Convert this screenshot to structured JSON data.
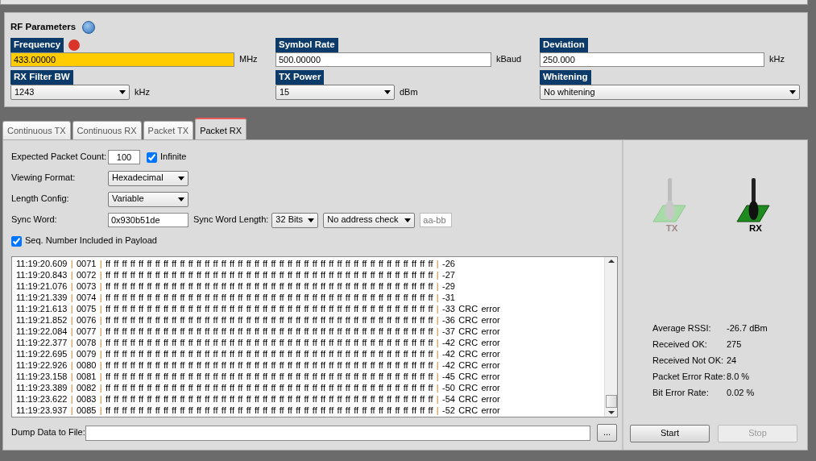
{
  "rf_parameters": {
    "title": "RF Parameters",
    "fields": [
      {
        "label": "Frequency",
        "kind": "input",
        "value": "433.00000",
        "unit": "MHz",
        "warning": true
      },
      {
        "label": "Symbol Rate",
        "kind": "input",
        "value": "500.00000",
        "unit": "kBaud",
        "warning": false
      },
      {
        "label": "Deviation",
        "kind": "input",
        "value": "250.000",
        "unit": "kHz",
        "warning": false
      },
      {
        "label": "RX Filter BW",
        "kind": "select",
        "value": "1243",
        "unit": "kHz",
        "warning": false
      },
      {
        "label": "TX Power",
        "kind": "select",
        "value": "15",
        "unit": "dBm",
        "warning": false
      },
      {
        "label": "Whitening",
        "kind": "select",
        "value": "No whitening",
        "warning": false
      }
    ]
  },
  "tabs": [
    {
      "label": "Continuous TX",
      "selected": false
    },
    {
      "label": "Continuous RX",
      "selected": false
    },
    {
      "label": "Packet TX",
      "selected": false
    },
    {
      "label": "Packet RX",
      "selected": true
    }
  ],
  "packet_rx": {
    "expected_packet_count": {
      "label": "Expected Packet Count:",
      "value": "100"
    },
    "infinite": {
      "label": "Infinite",
      "checked": true
    },
    "viewing_format": {
      "label": "Viewing Format:",
      "value": "Hexadecimal"
    },
    "length_config": {
      "label": "Length Config:",
      "value": "Variable"
    },
    "sync_word": {
      "label": "Sync Word:",
      "value": "0x930b51de"
    },
    "sync_word_length": {
      "label": "Sync Word Length:",
      "value": "32 Bits"
    },
    "address_check": {
      "value": "No address check"
    },
    "address": {
      "value": "aa-bb",
      "disabled": true
    },
    "seq_number": {
      "label": "Seq. Number Included in Payload",
      "checked": true
    },
    "log": [
      {
        "line": "11:19:20.609 | 0071 | ff ff ff ff ff ff ff ff ff ff ff ff ff ff ff ff ff ff ff ff ff ff ff ff ff ff ff ff ff ff ff ff ff ff ff ff ff ff ff ff  |  -26"
      },
      {
        "line": "11:19:20.843 | 0072 | ff ff ff ff ff ff ff ff ff ff ff ff ff ff ff ff ff ff ff ff ff ff ff ff ff ff ff ff ff ff ff ff ff ff ff ff ff ff ff ff  |  -27"
      },
      {
        "line": "11:19:21.076 | 0073 | ff ff ff ff ff ff ff ff ff ff ff ff ff ff ff ff ff ff ff ff ff ff ff ff ff ff ff ff ff ff ff ff ff ff ff ff ff ff ff ff  |  -29"
      },
      {
        "line": "11:19:21.339 | 0074 | ff ff ff ff ff ff ff ff ff ff ff ff ff ff ff ff ff ff ff ff ff ff ff ff ff ff ff ff ff ff ff ff ff ff ff ff ff ff ff ff  |  -31"
      },
      {
        "line": "11:19:21.613 | 0075 | ff ff ff ff ff ff ff ff ff ff ff ff ff ff ff ff ff ff ff ff ff ff ff ff ff ff ff ff ff ff ff ff ff ff ff ff ff ff ff ff  |  -33 CRC error"
      },
      {
        "line": "11:19:21.852 | 0076 | ff ff ff ff ff ff ff ff ff ff ff ff ff ff ff ff ff ff ff ff ff ff ff ff ff ff ff ff ff ff ff ff ff ff ff ff ff ff ff ff  |  -36 CRC error"
      },
      {
        "line": "11:19:22.084 | 0077 | ff ff ff ff ff ff ff ff ff ff ff ff ff ff ff ff ff ff ff ff ff ff ff ff ff ff ff ff ff ff ff ff ff ff ff ff ff ff ff ff  |  -37 CRC error"
      },
      {
        "line": "11:19:22.377 | 0078 | ff ff ff ff ff ff ff ff ff ff ff ff ff ff ff ff ff ff ff ff ff ff ff ff ff ff ff ff ff ff ff ff ff ff ff ff ff ff ff ff  |  -42 CRC error"
      },
      {
        "line": "11:19:22.695 | 0079 | ff ff ff ff ff ff ff ff ff ff ff ff ff ff ff ff ff ff ff ff ff ff ff ff ff ff ff ff ff ff ff ff ff ff ff ff ff ff ff ff  |  -42 CRC error"
      },
      {
        "line": "11:19:22.926 | 0080 | ff ff ff ff ff ff ff ff ff ff ff ff ff ff ff ff ff ff ff ff ff ff ff ff ff ff ff ff ff ff ff ff ff ff ff ff ff ff ff ff  |  -42 CRC error"
      },
      {
        "line": "11:19:23.158 | 0081 | ff ff ff ff ff ff ff ff ff ff ff ff ff ff ff ff ff ff ff ff ff ff ff ff ff ff ff ff ff ff ff ff ff ff ff ff ff ff ff ff  |  -45 CRC error"
      },
      {
        "line": "11:19:23.389 | 0082 | ff ff ff ff ff ff ff ff ff ff ff ff ff ff ff ff ff ff ff ff ff ff ff ff ff ff ff ff ff ff ff ff ff ff ff ff ff ff ff ff  |  -50 CRC error"
      },
      {
        "line": "11:19:23.622 | 0083 | ff ff ff ff ff ff ff ff ff ff ff ff ff ff ff ff ff ff ff ff ff ff ff ff ff ff ff ff ff ff ff ff ff ff ff ff ff ff ff ff  |  -54 CRC error"
      },
      {
        "line": "11:19:23.937 | 0085 | ff ff ff ff ff ff ff ff ff ff ff ff ff ff ff ff ff ff ff ff ff ff ff ff ff ff ff ff ff ff ff ff ff ff ff ff ff ff ff ff  |  -52 CRC error"
      }
    ],
    "dump": {
      "label": "Dump Data to File:",
      "browse": "..."
    },
    "indicators": [
      {
        "label": "TX",
        "active": false
      },
      {
        "label": "RX",
        "active": true
      }
    ],
    "stats": [
      {
        "label": "Average RSSI:",
        "value": "-26.7 dBm"
      },
      {
        "label": "Received OK:",
        "value": "275"
      },
      {
        "label": "Received Not OK:",
        "value": "24"
      },
      {
        "label": "Packet Error Rate:",
        "value": "8.0 %"
      },
      {
        "label": "Bit Error Rate:",
        "value": "0.02 %"
      }
    ],
    "buttons": [
      {
        "label": "Start",
        "disabled": false
      },
      {
        "label": "Stop",
        "disabled": true
      }
    ]
  }
}
